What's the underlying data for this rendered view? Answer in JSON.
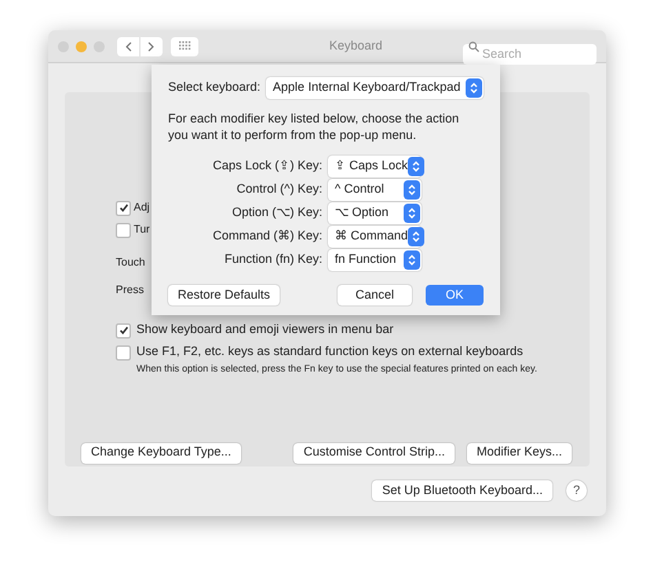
{
  "window": {
    "title": "Keyboard",
    "search": {
      "placeholder": "Search"
    }
  },
  "background": {
    "options_top": [
      {
        "label": "Adj",
        "checked": true
      },
      {
        "label": "Tur",
        "checked": false
      }
    ],
    "labels": [
      "Touch",
      "Press"
    ],
    "options_bottom": [
      {
        "label": "Show keyboard and emoji viewers in menu bar",
        "checked": true
      },
      {
        "label": "Use F1, F2, etc. keys as standard function keys on external keyboards",
        "checked": false
      }
    ],
    "note": "When this option is selected, press the Fn key to use the special features printed on each key.",
    "buttons": [
      "Change Keyboard Type...",
      "Customise Control Strip...",
      "Modifier Keys..."
    ],
    "bluetooth_button": "Set Up Bluetooth Keyboard...",
    "help": "?"
  },
  "sheet": {
    "select_label": "Select keyboard:",
    "keyboard": "Apple Internal Keyboard/Trackpad",
    "description": "For each modifier key listed below, choose the action you want it to perform from the pop-up menu.",
    "modifiers": [
      {
        "label": "Caps Lock (⇪) Key:",
        "value": "⇪ Caps Lock"
      },
      {
        "label": "Control (^) Key:",
        "value": "^ Control"
      },
      {
        "label": "Option (⌥) Key:",
        "value": "⌥ Option"
      },
      {
        "label": "Command (⌘) Key:",
        "value": "⌘ Command"
      },
      {
        "label": "Function (fn) Key:",
        "value": "fn Function"
      }
    ],
    "restore": "Restore Defaults",
    "cancel": "Cancel",
    "ok": "OK"
  }
}
